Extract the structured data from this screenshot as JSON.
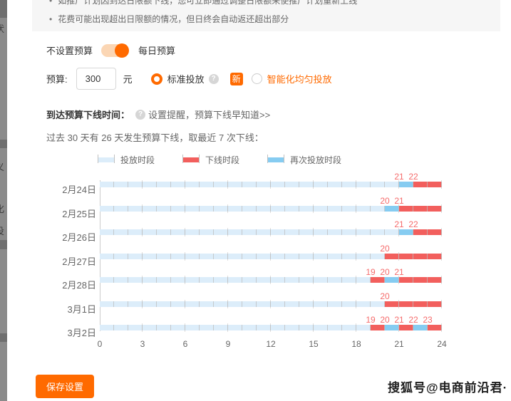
{
  "notice": {
    "items": [
      "如推广计划因到达日限额下线，您可立即通过调整日限额来使推广计划重新上线",
      "花费可能出现超出日限额的情况，但日终会自动返还超出部分"
    ]
  },
  "budget": {
    "toggle_off_label": "不设置预算",
    "toggle_on_label": "每日预算",
    "toggle_state": "on",
    "field_label": "预算:",
    "value": "300",
    "unit": "元",
    "radio_standard": "标准投放",
    "new_badge": "新",
    "radio_smart": "智能化均匀投放",
    "help_icon_glyph": "?"
  },
  "offline_info": {
    "title": "到达预算下线时间：",
    "reminder": "设置提醒，预算下线早知道>>",
    "stats": "过去 30 天有 26 天发生预算下线，取最近 7 次下线："
  },
  "chart_data": {
    "type": "heatmap",
    "subtype": "daily-timeline-bars",
    "x_range": [
      0,
      24
    ],
    "x_ticks": [
      0,
      3,
      6,
      9,
      12,
      15,
      18,
      21,
      24
    ],
    "grid": true,
    "legend_position": "top",
    "legend": [
      {
        "key": "delivery",
        "label": "投放时段",
        "color": "#dcedfa"
      },
      {
        "key": "offline",
        "label": "下线时段",
        "color": "#f25f5d"
      },
      {
        "key": "redelivery",
        "label": "再次投放时段",
        "color": "#86ccf1"
      }
    ],
    "colors": {
      "delivery": "#dcedfa",
      "offline": "#f25f5d",
      "redelivery": "#86ccf1",
      "label": "#f56c6c"
    },
    "rows": [
      {
        "date": "2月24日",
        "segments": [
          {
            "start": 0,
            "end": 21,
            "type": "delivery"
          },
          {
            "start": 21,
            "end": 22,
            "type": "redelivery"
          },
          {
            "start": 22,
            "end": 24,
            "type": "offline"
          }
        ],
        "labels": [
          21,
          22
        ]
      },
      {
        "date": "2月25日",
        "segments": [
          {
            "start": 0,
            "end": 20,
            "type": "delivery"
          },
          {
            "start": 20,
            "end": 21,
            "type": "redelivery"
          },
          {
            "start": 21,
            "end": 24,
            "type": "offline"
          }
        ],
        "labels": [
          20,
          21
        ]
      },
      {
        "date": "2月26日",
        "segments": [
          {
            "start": 0,
            "end": 21,
            "type": "delivery"
          },
          {
            "start": 21,
            "end": 22,
            "type": "redelivery"
          },
          {
            "start": 22,
            "end": 24,
            "type": "offline"
          }
        ],
        "labels": [
          21,
          22
        ]
      },
      {
        "date": "2月27日",
        "segments": [
          {
            "start": 0,
            "end": 20,
            "type": "delivery"
          },
          {
            "start": 20,
            "end": 24,
            "type": "offline"
          }
        ],
        "labels": [
          20
        ]
      },
      {
        "date": "2月28日",
        "segments": [
          {
            "start": 0,
            "end": 19,
            "type": "delivery"
          },
          {
            "start": 19,
            "end": 20,
            "type": "offline"
          },
          {
            "start": 20,
            "end": 21,
            "type": "redelivery"
          },
          {
            "start": 21,
            "end": 24,
            "type": "offline"
          }
        ],
        "labels": [
          19,
          20,
          21
        ]
      },
      {
        "date": "3月1日",
        "segments": [
          {
            "start": 0,
            "end": 20,
            "type": "delivery"
          },
          {
            "start": 20,
            "end": 24,
            "type": "offline"
          }
        ],
        "labels": [
          20
        ]
      },
      {
        "date": "3月2日",
        "segments": [
          {
            "start": 0,
            "end": 19,
            "type": "delivery"
          },
          {
            "start": 19,
            "end": 20,
            "type": "offline"
          },
          {
            "start": 20,
            "end": 21,
            "type": "redelivery"
          },
          {
            "start": 21,
            "end": 22,
            "type": "offline"
          },
          {
            "start": 22,
            "end": 23,
            "type": "redelivery"
          },
          {
            "start": 23,
            "end": 24,
            "type": "offline"
          }
        ],
        "labels": [
          19,
          20,
          21,
          22,
          23
        ]
      }
    ]
  },
  "footer": {
    "save_label": "保存设置"
  },
  "watermark": "搜狐号@电商前沿君·",
  "sidebar_fragments": [
    "状",
    "义",
    "化",
    "投"
  ]
}
